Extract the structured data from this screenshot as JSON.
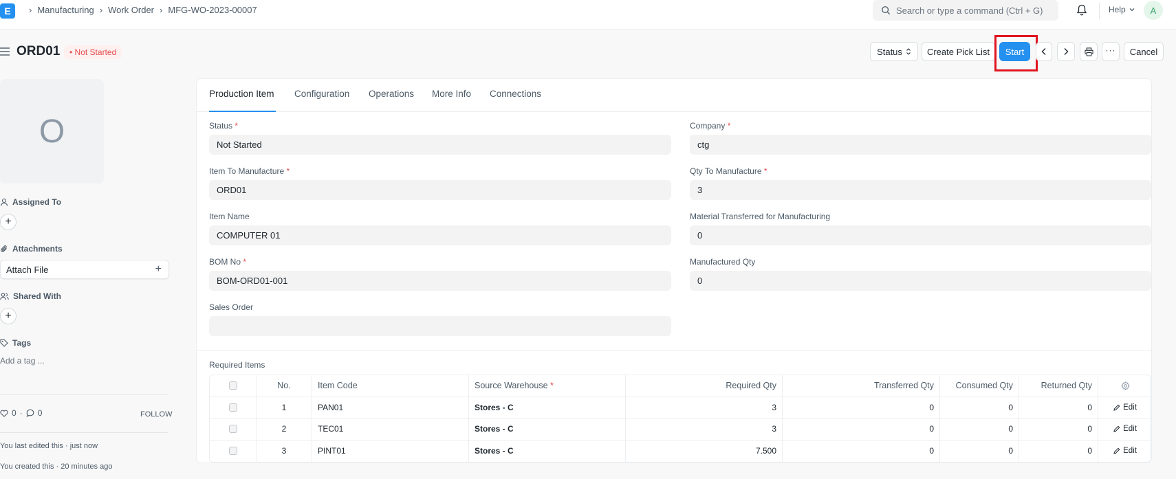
{
  "navbar": {
    "logo_letter": "E",
    "breadcrumbs": [
      "Manufacturing",
      "Work Order",
      "MFG-WO-2023-00007"
    ],
    "search_placeholder": "Search or type a command (Ctrl + G)",
    "help_label": "Help",
    "avatar_letter": "A"
  },
  "page": {
    "title": "ORD01",
    "status": "Not Started",
    "actions": {
      "status": "Status",
      "create_pick_list": "Create Pick List",
      "start": "Start",
      "cancel": "Cancel"
    }
  },
  "sidebar": {
    "avatar_letter": "O",
    "assigned_to": "Assigned To",
    "attachments": "Attachments",
    "attach_file": "Attach File",
    "shared_with": "Shared With",
    "tags": "Tags",
    "add_tag": "Add a tag ...",
    "likes": "0",
    "comments": "0",
    "follow": "FOLLOW",
    "last_edited": "You last edited this · just now",
    "created": "You created this · 20 minutes ago"
  },
  "tabs": [
    "Production Item",
    "Configuration",
    "Operations",
    "More Info",
    "Connections"
  ],
  "form": {
    "status_label": "Status",
    "status_value": "Not Started",
    "company_label": "Company",
    "company_value": "ctg",
    "item_label": "Item To Manufacture",
    "item_value": "ORD01",
    "qty_label": "Qty To Manufacture",
    "qty_value": "3",
    "item_name_label": "Item Name",
    "item_name_value": "COMPUTER 01",
    "material_label": "Material Transferred for Manufacturing",
    "material_value": "0",
    "bom_label": "BOM No",
    "bom_value": "BOM-ORD01-001",
    "manufactured_label": "Manufactured Qty",
    "manufactured_value": "0",
    "sales_order_label": "Sales Order",
    "sales_order_value": ""
  },
  "required_items": {
    "title": "Required Items",
    "headers": {
      "no": "No.",
      "item_code": "Item Code",
      "source_warehouse": "Source Warehouse",
      "required_qty": "Required Qty",
      "transferred_qty": "Transferred Qty",
      "consumed_qty": "Consumed Qty",
      "returned_qty": "Returned Qty"
    },
    "edit_label": "Edit",
    "rows": [
      {
        "no": "1",
        "item_code": "PAN01",
        "warehouse": "Stores - C",
        "required": "3",
        "transferred": "0",
        "consumed": "0",
        "returned": "0"
      },
      {
        "no": "2",
        "item_code": "TEC01",
        "warehouse": "Stores - C",
        "required": "3",
        "transferred": "0",
        "consumed": "0",
        "returned": "0"
      },
      {
        "no": "3",
        "item_code": "PINT01",
        "warehouse": "Stores - C",
        "required": "7.500",
        "transferred": "0",
        "consumed": "0",
        "returned": "0"
      }
    ]
  }
}
